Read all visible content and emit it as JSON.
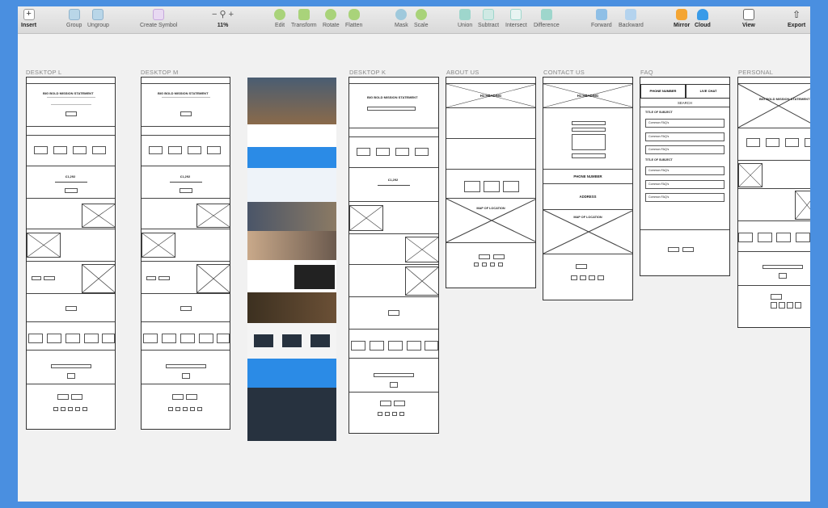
{
  "toolbar": {
    "insert": "Insert",
    "group": "Group",
    "ungroup": "Ungroup",
    "create_symbol": "Create Symbol",
    "zoom_level": "11%",
    "edit": "Edit",
    "transform": "Transform",
    "rotate": "Rotate",
    "flatten": "Flatten",
    "mask": "Mask",
    "scale": "Scale",
    "union": "Union",
    "subtract": "Subtract",
    "intersect": "Intersect",
    "difference": "Difference",
    "forward": "Forward",
    "backward": "Backward",
    "mirror": "Mirror",
    "cloud": "Cloud",
    "view": "View",
    "export": "Export"
  },
  "artboards": {
    "desktop_l": "DESKTOP L",
    "desktop_m": "DESKTOP M",
    "desktop_k": "DESKTOP K",
    "about_us": "ABOUT US",
    "contact_us": "CONTACT US",
    "faq": "FAQ",
    "personal": "PERSONAL"
  },
  "wire": {
    "mission": "BIG BOLD MISSION STATEMENT",
    "amount": "£1,292",
    "h1_heading": "H1 HEADING",
    "map": "MAP OF LOCATION",
    "phone_number": "PHONE NUMBER",
    "address": "ADDRESS",
    "live_chat": "LIVE CHAT",
    "search": "SEARCH",
    "title_subject": "TITLE OF SUBJECT",
    "common_faq": "Common FAQ's"
  },
  "colors": {
    "accent_blue": "#2b8be6",
    "dark_navy": "#27323f",
    "background": "#4a8fe0"
  }
}
